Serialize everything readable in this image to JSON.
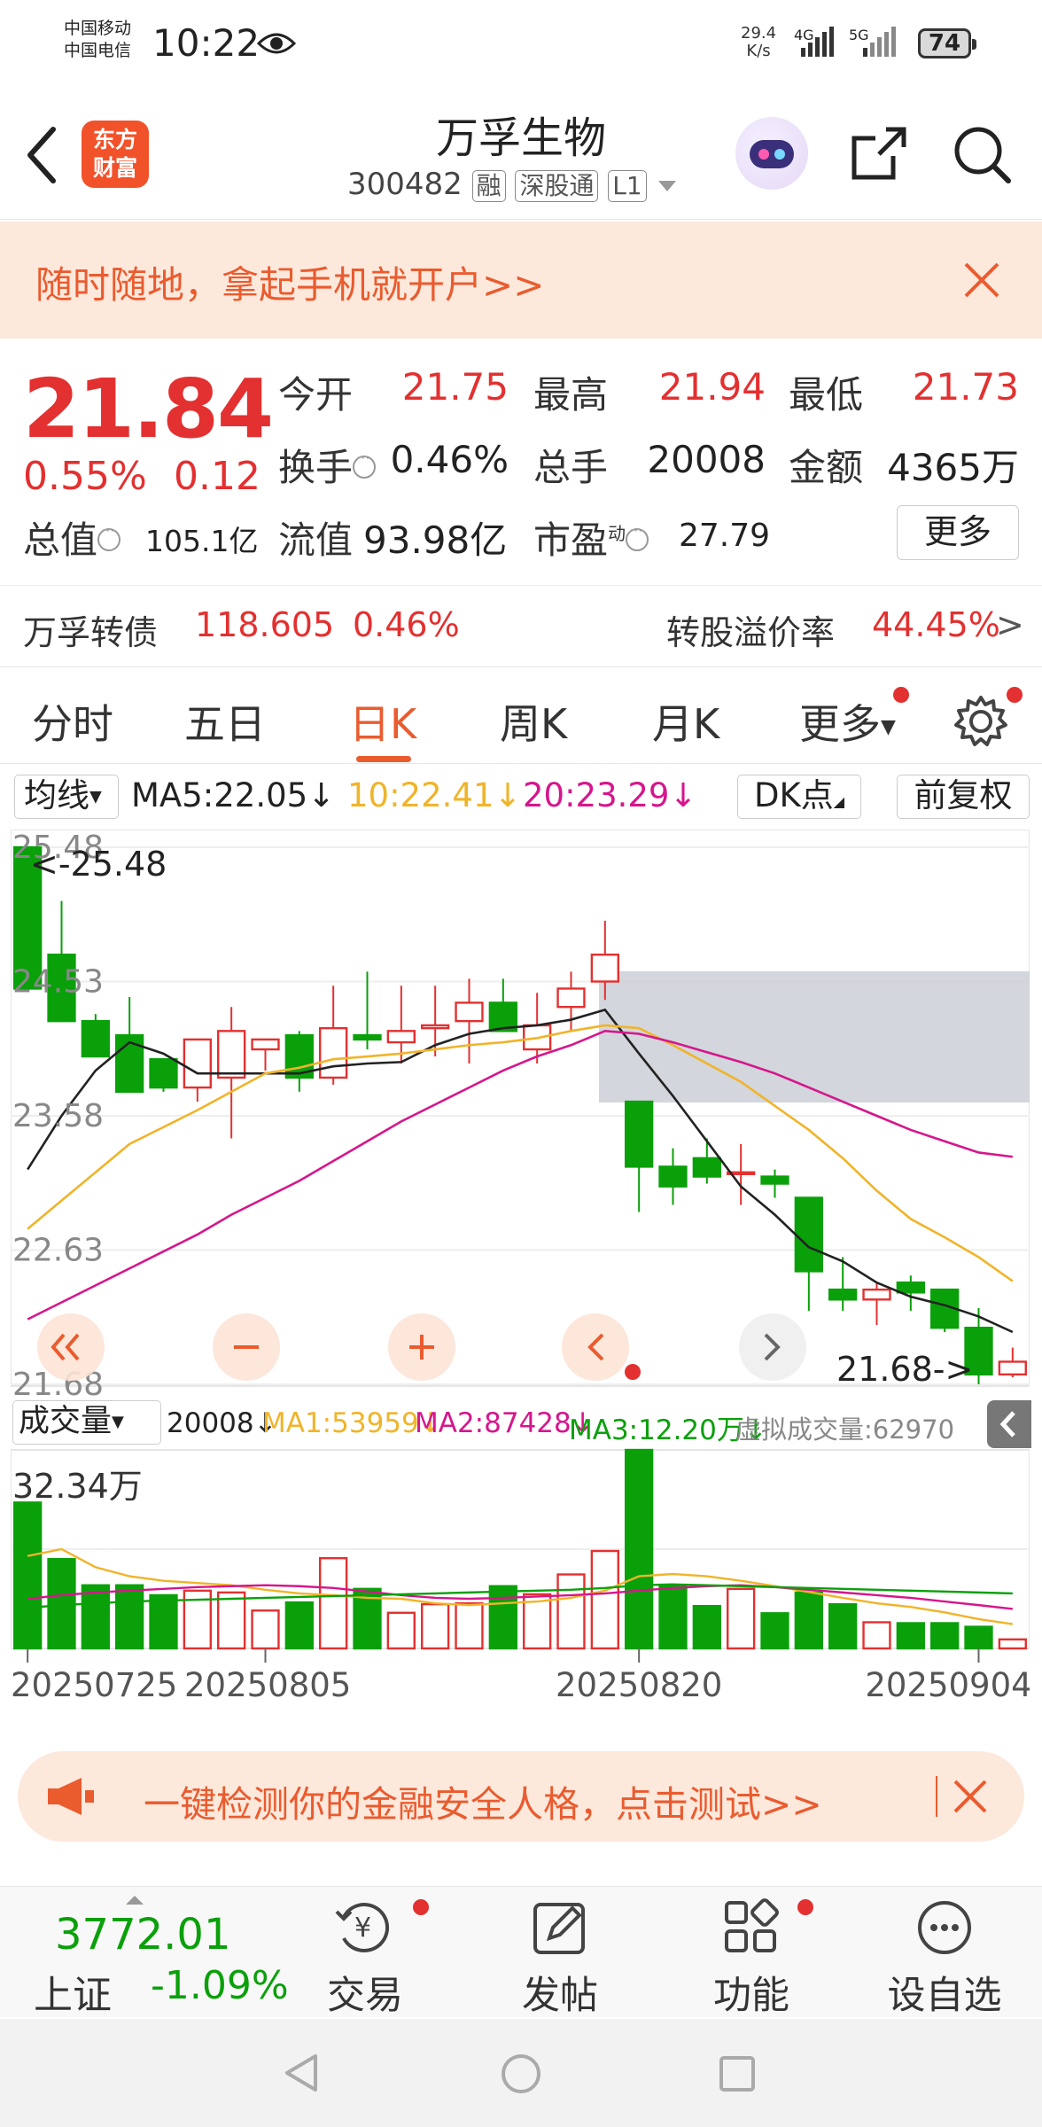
{
  "status_bar": {
    "carrier1": "中国移动",
    "carrier2": "中国电信",
    "time": "10:22",
    "net_speed_value": "29.4",
    "net_speed_unit": "K/s",
    "net1": "4G",
    "net2": "5G",
    "battery": "74"
  },
  "header": {
    "logo_line1": "东方",
    "logo_line2": "财富",
    "stock_name": "万孚生物",
    "stock_code": "300482",
    "tag1": "融",
    "tag2": "深股通",
    "tag3": "L1"
  },
  "banner": {
    "text": "随时随地，拿起手机就开户>>"
  },
  "quote": {
    "price": "21.84",
    "change_pct": "0.55%",
    "change": "0.12",
    "open_label": "今开",
    "open": "21.75",
    "high_label": "最高",
    "high": "21.94",
    "low_label": "最低",
    "low": "21.73",
    "turnover_label": "换手",
    "turnover": "0.46%",
    "volume_label": "总手",
    "volume": "20008",
    "amount_label": "金额",
    "amount": "4365万",
    "mcap_label": "总值",
    "mcap": "105.1亿",
    "float_label": "流值",
    "float": "93.98亿",
    "pe_label": "市盈",
    "pe_sup": "动",
    "pe": "27.79",
    "more": "更多"
  },
  "bond": {
    "name": "万孚转债",
    "price": "118.605",
    "pct": "0.46%",
    "premium_label": "转股溢价率",
    "premium": "44.45%",
    "arrow": ">"
  },
  "tabs": [
    "分时",
    "五日",
    "日K",
    "周K",
    "月K",
    "更多"
  ],
  "active_tab": "日K",
  "ma_row": {
    "selector": "均线",
    "ma5": "MA5:22.05↓",
    "ma10": "10:22.41↓",
    "ma20": "20:23.29↓",
    "dk": "DK点",
    "fq": "前复权"
  },
  "colors": {
    "up": "#e33030",
    "down": "#0aa00a",
    "ma5": "#222222",
    "ma10": "#f0b429",
    "ma20": "#d6168c",
    "accent": "#ea5b2e"
  },
  "chart_data": {
    "type": "candlestick",
    "y_ticks": [
      "25.48",
      "24.53",
      "23.58",
      "22.63",
      "21.68"
    ],
    "ylim": [
      21.68,
      25.48
    ],
    "max_label": "<-25.48",
    "min_label": "21.68->",
    "ohlc": [
      [
        25.48,
        25.48,
        24.48,
        24.48
      ],
      [
        24.72,
        25.1,
        24.25,
        24.25
      ],
      [
        24.25,
        24.3,
        24.0,
        24.0
      ],
      [
        24.15,
        24.42,
        23.75,
        23.75
      ],
      [
        23.98,
        23.98,
        23.75,
        23.78
      ],
      [
        23.78,
        24.05,
        23.68,
        24.12
      ],
      [
        23.85,
        24.35,
        23.42,
        24.18
      ],
      [
        24.05,
        24.12,
        23.9,
        24.12
      ],
      [
        24.15,
        24.18,
        23.75,
        23.85
      ],
      [
        23.85,
        24.5,
        23.8,
        24.2
      ],
      [
        24.15,
        24.6,
        24.05,
        24.12
      ],
      [
        24.1,
        24.5,
        23.95,
        24.18
      ],
      [
        24.2,
        24.5,
        24.0,
        24.22
      ],
      [
        24.25,
        24.55,
        23.95,
        24.38
      ],
      [
        24.38,
        24.55,
        24.18,
        24.18
      ],
      [
        24.05,
        24.45,
        23.95,
        24.22
      ],
      [
        24.35,
        24.6,
        24.18,
        24.48
      ],
      [
        24.53,
        24.96,
        24.4,
        24.72
      ],
      [
        23.68,
        23.68,
        22.9,
        23.22
      ],
      [
        23.22,
        23.35,
        22.95,
        23.08
      ],
      [
        23.28,
        23.42,
        23.1,
        23.15
      ],
      [
        23.18,
        23.38,
        22.95,
        23.18
      ],
      [
        23.15,
        23.2,
        23.0,
        23.1
      ],
      [
        23.0,
        23.0,
        22.2,
        22.48
      ],
      [
        22.35,
        22.58,
        22.2,
        22.28
      ],
      [
        22.28,
        22.4,
        22.1,
        22.35
      ],
      [
        22.4,
        22.45,
        22.2,
        22.33
      ],
      [
        22.35,
        22.35,
        22.05,
        22.08
      ],
      [
        22.08,
        22.22,
        21.68,
        21.75
      ],
      [
        21.75,
        21.94,
        21.73,
        21.84
      ]
    ],
    "ma_lines": [
      {
        "name": "MA5",
        "values": [
          23.2,
          23.58,
          23.9,
          24.1,
          24.02,
          23.88,
          23.88,
          23.88,
          23.88,
          23.93,
          23.95,
          23.96,
          24.08,
          24.16,
          24.2,
          24.22,
          24.26,
          24.33,
          24.02,
          23.72,
          23.4,
          23.08,
          22.88,
          22.65,
          22.55,
          22.4,
          22.3,
          22.24,
          22.16,
          22.05
        ]
      },
      {
        "name": "MA10",
        "values": [
          22.78,
          22.98,
          23.18,
          23.38,
          23.5,
          23.62,
          23.75,
          23.88,
          23.92,
          23.98,
          24.0,
          24.02,
          24.05,
          24.08,
          24.1,
          24.13,
          24.18,
          24.22,
          24.2,
          24.08,
          23.95,
          23.82,
          23.65,
          23.48,
          23.28,
          23.05,
          22.85,
          22.72,
          22.58,
          22.41
        ]
      },
      {
        "name": "MA20",
        "values": [
          22.14,
          22.26,
          22.38,
          22.5,
          22.62,
          22.74,
          22.88,
          23.0,
          23.12,
          23.26,
          23.4,
          23.54,
          23.66,
          23.78,
          23.9,
          24.0,
          24.08,
          24.18,
          24.16,
          24.1,
          24.03,
          23.96,
          23.88,
          23.78,
          23.68,
          23.58,
          23.48,
          23.4,
          23.32,
          23.29
        ]
      }
    ],
    "volume_label": "成交量",
    "volume_now": "20008↓",
    "vol_ma1": "MA1:53959↓",
    "vol_ma2": "MA2:87428↓",
    "vol_ma3": "MA3:12.20万↓",
    "vol_virtual": "虚拟成交量:62970",
    "vol_max_label": "32.34万",
    "volume": [
      323400,
      198000,
      140000,
      140000,
      118000,
      128000,
      124000,
      84000,
      102000,
      200000,
      132000,
      79000,
      98000,
      100000,
      138000,
      120000,
      164000,
      216000,
      440000,
      138000,
      94000,
      132000,
      78000,
      124000,
      98000,
      58000,
      56000,
      56000,
      48000,
      20008
    ],
    "vol_ma1_values": [
      205000,
      220000,
      180000,
      160000,
      150000,
      145000,
      140000,
      130000,
      122000,
      118000,
      112000,
      110000,
      100000,
      96000,
      100000,
      104000,
      112000,
      128000,
      160000,
      165000,
      160000,
      150000,
      138000,
      125000,
      112000,
      100000,
      92000,
      80000,
      65000,
      53959
    ],
    "vol_ma2_values": [
      110000,
      118000,
      124000,
      128000,
      132000,
      136000,
      138000,
      140000,
      138000,
      134000,
      126000,
      118000,
      112000,
      110000,
      112000,
      115000,
      118000,
      122000,
      128000,
      134000,
      138000,
      140000,
      136000,
      130000,
      124000,
      118000,
      112000,
      104000,
      96000,
      87428
    ],
    "vol_ma3_values": [
      90000,
      96000,
      100000,
      104000,
      106000,
      108000,
      110000,
      112000,
      114000,
      116000,
      118000,
      120000,
      122000,
      124000,
      126000,
      128000,
      130000,
      134000,
      140000,
      142000,
      140000,
      138000,
      136000,
      134000,
      132000,
      130000,
      128000,
      126000,
      124000,
      122000
    ],
    "x_dates": [
      "20250725",
      "20250805",
      "20250820",
      "20250904"
    ]
  },
  "bottom_ad": {
    "text": "一键检测你的金融安全人格，点击测试>>"
  },
  "bottom_bar": {
    "index_value": "3772.01",
    "index_name": "上证",
    "index_change": "-1.09%",
    "trade": "交易",
    "post": "发帖",
    "func": "功能",
    "watch": "设自选"
  }
}
